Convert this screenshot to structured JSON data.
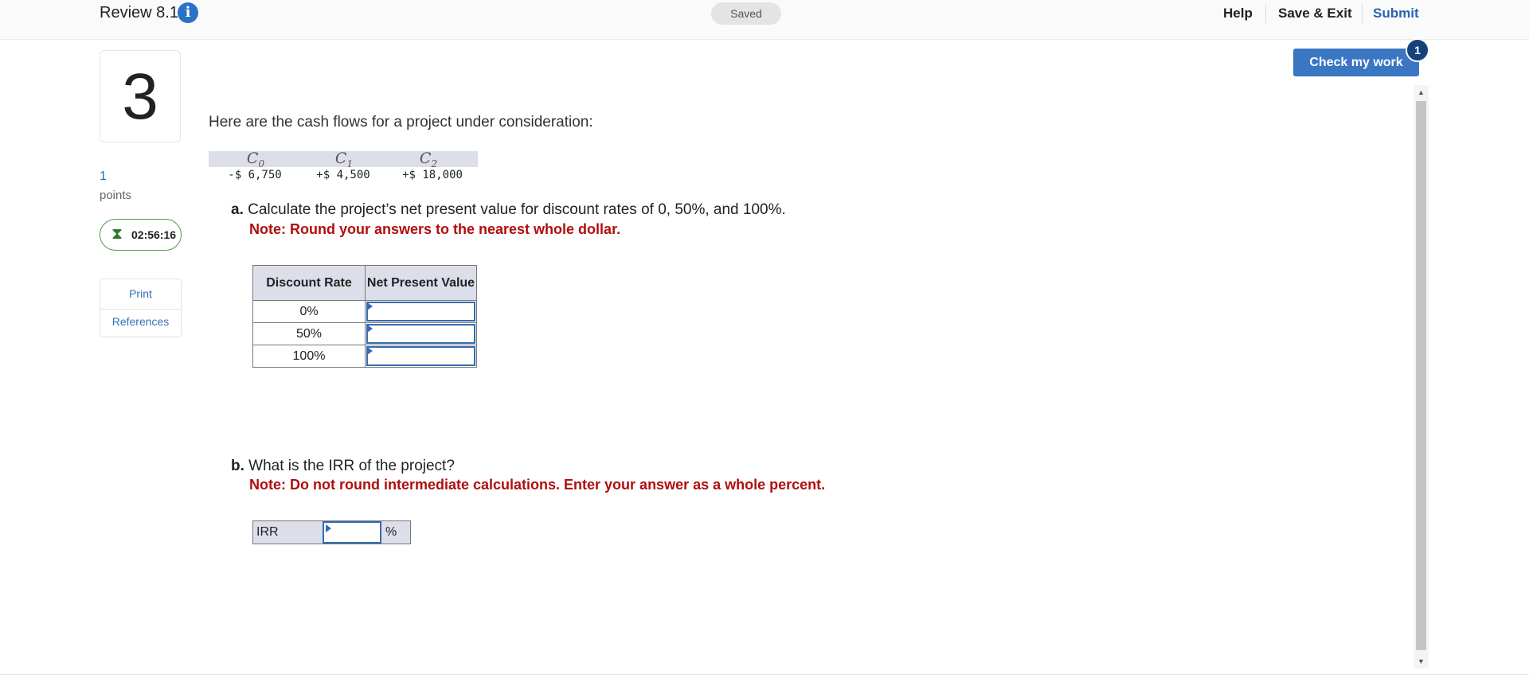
{
  "header": {
    "title": "Review 8.1",
    "info_icon": "i",
    "status": "Saved",
    "links": {
      "help": "Help",
      "save_exit": "Save & Exit",
      "submit": "Submit"
    }
  },
  "check_work": {
    "label": "Check my work",
    "badge": "1"
  },
  "sidebar": {
    "question_number": "3",
    "points_value": "1",
    "points_label": "points",
    "timer": "02:56:16",
    "links": [
      "Print",
      "References"
    ]
  },
  "question": {
    "intro": "Here are the cash flows for a project under consideration:",
    "cash_flows": [
      {
        "label": "C",
        "sub": "0",
        "value": "-$ 6,750"
      },
      {
        "label": "C",
        "sub": "1",
        "value": "+$ 4,500"
      },
      {
        "label": "C",
        "sub": "2",
        "value": "+$ 18,000"
      }
    ],
    "part_a": {
      "letter": "a.",
      "text": "Calculate the project’s net present value for discount rates of 0, 50%, and 100%.",
      "note": "Note: Round your answers to the nearest whole dollar.",
      "table": {
        "col1": "Discount Rate",
        "col2": "Net Present Value",
        "rows": [
          "0%",
          "50%",
          "100%"
        ]
      }
    },
    "part_b": {
      "letter": "b.",
      "text": "What is the IRR of the project?",
      "note": "Note: Do not round intermediate calculations. Enter your answer as a whole percent.",
      "irr_label": "IRR",
      "irr_unit": "%"
    }
  },
  "colors": {
    "accent": "#3a76c2",
    "note_red": "#b10e0e",
    "timer_green": "#4f9a4b",
    "table_header": "#dcdfea"
  },
  "icons": [
    "info-icon",
    "hourglass-icon",
    "scroll-up-arrow-icon",
    "scroll-down-arrow-icon"
  ]
}
